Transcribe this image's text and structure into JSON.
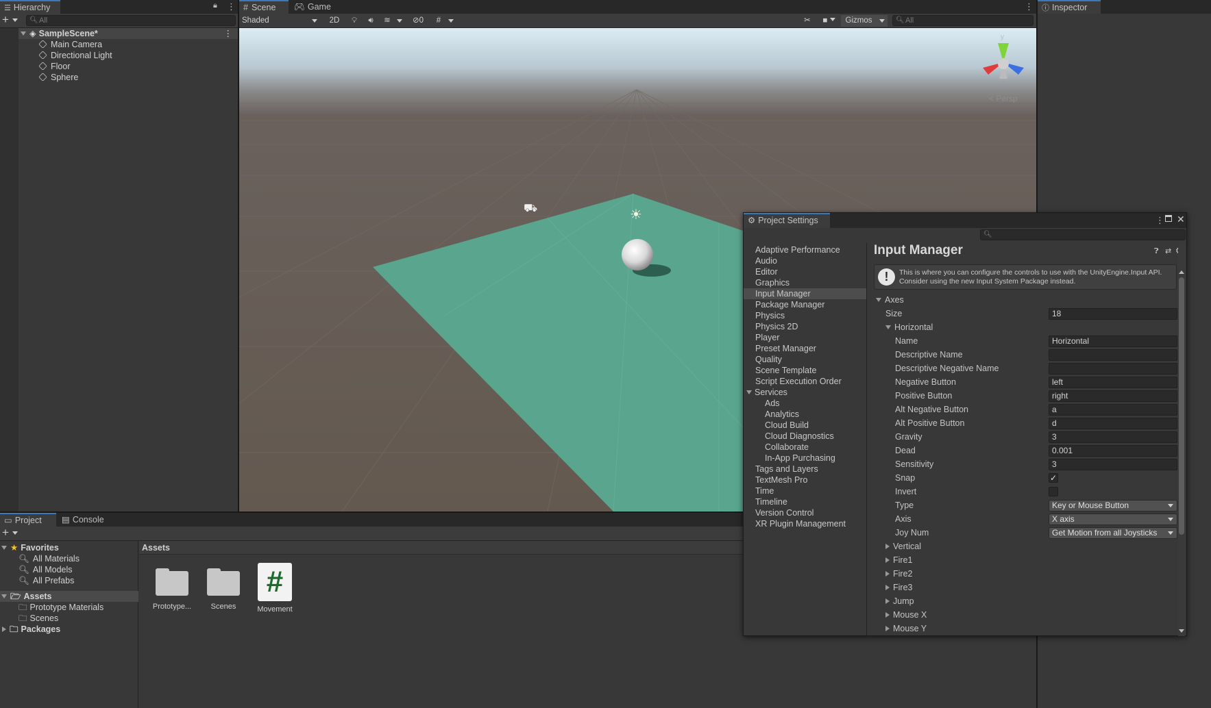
{
  "hierarchy": {
    "tab_label": "Hierarchy",
    "search_placeholder": "All",
    "scene_name": "SampleScene*",
    "items": [
      {
        "label": "Main Camera"
      },
      {
        "label": "Directional Light"
      },
      {
        "label": "Floor"
      },
      {
        "label": "Sphere"
      }
    ]
  },
  "scene": {
    "tabs": [
      {
        "label": "Scene"
      },
      {
        "label": "Game"
      }
    ],
    "shading_mode": "Shaded",
    "toggle_2d": "2D",
    "hidden_count": "0",
    "gizmos_label": "Gizmos",
    "search_placeholder": "All",
    "gizmo": {
      "y": "y",
      "x": "x",
      "z": "z",
      "projection": "Persp"
    }
  },
  "inspector": {
    "tab_label": "Inspector"
  },
  "bottom": {
    "tabs": [
      {
        "label": "Project"
      },
      {
        "label": "Console"
      }
    ],
    "favorites": {
      "label": "Favorites",
      "items": [
        {
          "label": "All Materials"
        },
        {
          "label": "All Models"
        },
        {
          "label": "All Prefabs"
        }
      ]
    },
    "assets_root": {
      "label": "Assets",
      "items": [
        {
          "label": "Prototype Materials"
        },
        {
          "label": "Scenes"
        }
      ]
    },
    "packages_label": "Packages",
    "breadcrumb": "Assets",
    "grid": [
      {
        "label": "Prototype..."
      },
      {
        "label": "Scenes"
      },
      {
        "label": "Movement",
        "glyph": "#"
      }
    ]
  },
  "settings": {
    "window_title": "Project Settings",
    "categories": [
      {
        "label": "Adaptive Performance"
      },
      {
        "label": "Audio"
      },
      {
        "label": "Editor"
      },
      {
        "label": "Graphics"
      },
      {
        "label": "Input Manager"
      },
      {
        "label": "Package Manager"
      },
      {
        "label": "Physics"
      },
      {
        "label": "Physics 2D"
      },
      {
        "label": "Player"
      },
      {
        "label": "Preset Manager"
      },
      {
        "label": "Quality"
      },
      {
        "label": "Scene Template"
      },
      {
        "label": "Script Execution Order"
      },
      {
        "label": "Services"
      },
      {
        "label": "Ads"
      },
      {
        "label": "Analytics"
      },
      {
        "label": "Cloud Build"
      },
      {
        "label": "Cloud Diagnostics"
      },
      {
        "label": "Collaborate"
      },
      {
        "label": "In-App Purchasing"
      },
      {
        "label": "Tags and Layers"
      },
      {
        "label": "TextMesh Pro"
      },
      {
        "label": "Time"
      },
      {
        "label": "Timeline"
      },
      {
        "label": "Version Control"
      },
      {
        "label": "XR Plugin Management"
      }
    ],
    "selected_category": "Input Manager",
    "panel_title": "Input Manager",
    "info_line1": "This is where you can configure the controls to use with the UnityEngine.Input API.",
    "info_line2": "Consider using the new Input System Package instead.",
    "axes_label": "Axes",
    "size_label": "Size",
    "size_value": "18",
    "horizontal_label": "Horizontal",
    "props": [
      {
        "label": "Name",
        "value": "Horizontal"
      },
      {
        "label": "Descriptive Name",
        "value": ""
      },
      {
        "label": "Descriptive Negative Name",
        "value": ""
      },
      {
        "label": "Negative Button",
        "value": "left"
      },
      {
        "label": "Positive Button",
        "value": "right"
      },
      {
        "label": "Alt Negative Button",
        "value": "a"
      },
      {
        "label": "Alt Positive Button",
        "value": "d"
      },
      {
        "label": "Gravity",
        "value": "3"
      },
      {
        "label": "Dead",
        "value": "0.001"
      },
      {
        "label": "Sensitivity",
        "value": "3"
      }
    ],
    "snap_label": "Snap",
    "snap_checked": true,
    "invert_label": "Invert",
    "invert_checked": false,
    "type_label": "Type",
    "type_value": "Key or Mouse Button",
    "axis_label": "Axis",
    "axis_value": "X axis",
    "joy_label": "Joy Num",
    "joy_value": "Get Motion from all Joysticks",
    "collapsed_axes": [
      {
        "label": "Vertical"
      },
      {
        "label": "Fire1"
      },
      {
        "label": "Fire2"
      },
      {
        "label": "Fire3"
      },
      {
        "label": "Jump"
      },
      {
        "label": "Mouse X"
      },
      {
        "label": "Mouse Y"
      }
    ]
  }
}
